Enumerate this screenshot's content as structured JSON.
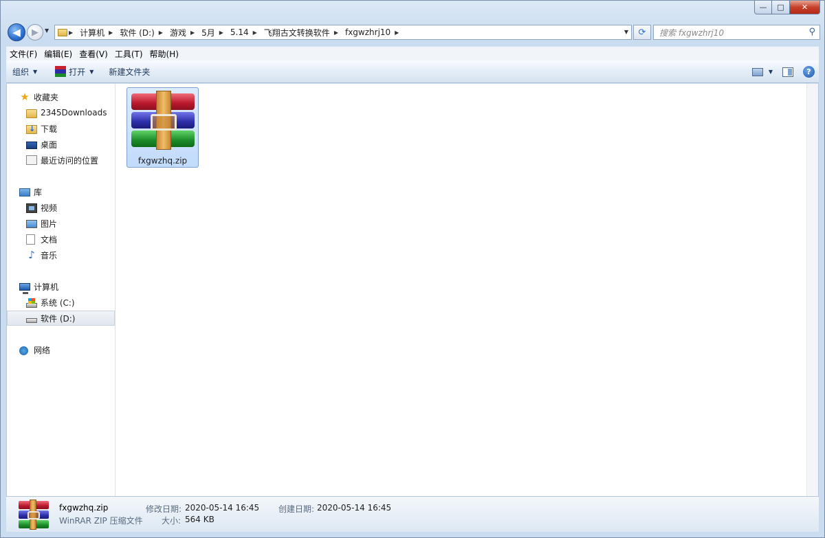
{
  "window": {
    "caption_buttons": {
      "minimize": "—",
      "maximize": "□",
      "close": "✕"
    }
  },
  "navigation": {
    "back_glyph": "◀",
    "forward_glyph": "▶",
    "breadcrumbs": [
      "计算机",
      "软件 (D:)",
      "游戏",
      "5月",
      "5.14",
      "飞翔古文转换软件",
      "fxgwzhrj10"
    ],
    "search_placeholder": "搜索 fxgwzhrj10"
  },
  "menu": [
    "文件(F)",
    "编辑(E)",
    "查看(V)",
    "工具(T)",
    "帮助(H)"
  ],
  "toolbar": {
    "organize": "组织",
    "open": "打开",
    "new_folder": "新建文件夹",
    "help": "?"
  },
  "sidebar": {
    "favorites": {
      "label": "收藏夹",
      "items": [
        "2345Downloads",
        "下载",
        "桌面",
        "最近访问的位置"
      ]
    },
    "libraries": {
      "label": "库",
      "items": [
        "视频",
        "图片",
        "文档",
        "音乐"
      ]
    },
    "computer": {
      "label": "计算机",
      "items": [
        "系统 (C:)",
        "软件 (D:)"
      ],
      "selected": "软件 (D:)"
    },
    "network": {
      "label": "网络"
    }
  },
  "files": [
    {
      "name": "fxgwzhq.zip",
      "icon": "winrar-archive-icon",
      "selected": true
    }
  ],
  "details": {
    "name": "fxgwzhq.zip",
    "type": "WinRAR ZIP 压缩文件",
    "modified_label": "修改日期:",
    "modified": "2020-05-14 16:45",
    "created_label": "创建日期:",
    "created": "2020-05-14 16:45",
    "size_label": "大小:",
    "size": "564 KB"
  },
  "colors": {
    "accent": "#2a6fd0",
    "selection": "#cce4fc",
    "close": "#c6402a"
  }
}
